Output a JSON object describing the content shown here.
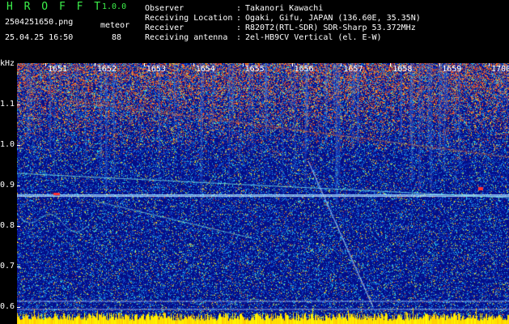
{
  "app": {
    "title": "H R O F F T",
    "version": "1.0.0"
  },
  "file": {
    "name": "2504251650.png",
    "datetime": "25.04.25 16:50"
  },
  "detection": {
    "mode": "meteor",
    "count": "88"
  },
  "info": [
    {
      "label": "Observer",
      "value": "Takanori Kawachi"
    },
    {
      "label": "Receiving Location",
      "value": "Ogaki, Gifu, JAPAN (136.60E, 35.35N)"
    },
    {
      "label": "Receiver",
      "value": "R820T2(RTL-SDR) SDR-Sharp 53.372MHz"
    },
    {
      "label": "Receiving antenna",
      "value": "2el-HB9CV Vertical (el. E-W)"
    }
  ],
  "colon": ":",
  "chart_data": {
    "type": "heatmap",
    "ylabel": "kHz",
    "y_ticks": [
      "1.1",
      "1.0",
      "0.9",
      "0.8",
      "0.7",
      "0.6"
    ],
    "x_ticks": [
      "1651",
      "1652",
      "1653",
      "1654",
      "1655",
      "1656",
      "1657",
      "1658",
      "1659",
      "1700"
    ],
    "colors": {
      "background": "#0a1a8c",
      "noise_hot": "#ff2020",
      "baseline": "#ffe000"
    }
  }
}
